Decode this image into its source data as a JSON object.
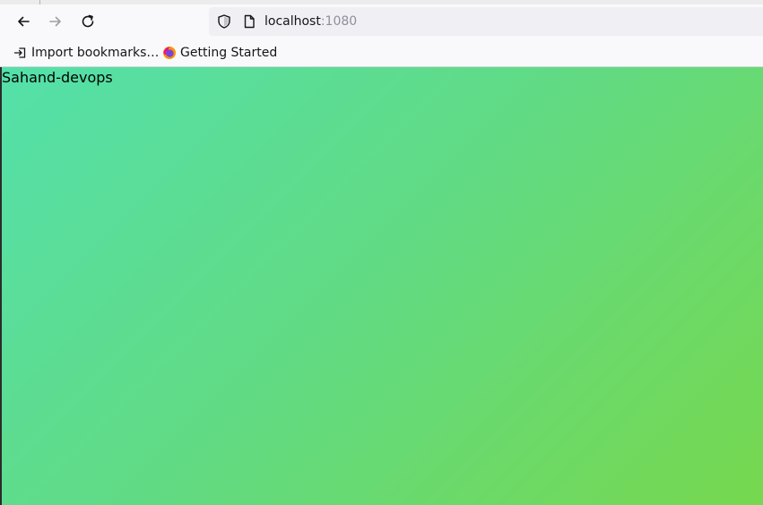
{
  "toolbar": {
    "back": "back-arrow-icon",
    "forward": "forward-arrow-icon",
    "reload": "reload-icon"
  },
  "urlbar": {
    "host": "localhost",
    "port": ":1080"
  },
  "bookmarks": {
    "items": [
      {
        "label": "Import bookmarks…",
        "icon": "import-icon"
      },
      {
        "label": "Getting Started",
        "icon": "firefox-icon"
      }
    ]
  },
  "page": {
    "text": "Sahand-devops",
    "gradient_start": "#54e0aa",
    "gradient_end": "#76d84e"
  }
}
